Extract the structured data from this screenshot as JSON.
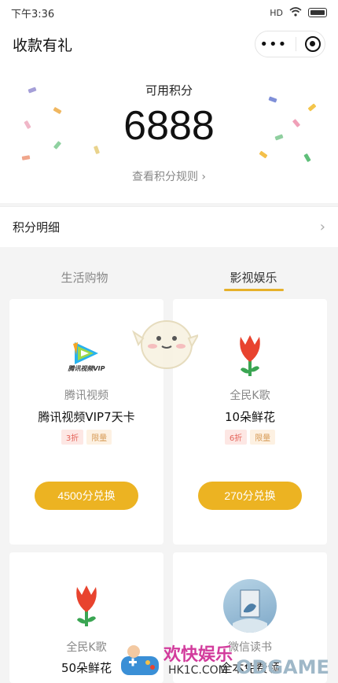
{
  "status_bar": {
    "time": "下午3:36",
    "signal": "HD",
    "wifi_icon": "wifi-icon",
    "battery_icon": "battery-icon"
  },
  "nav": {
    "title": "收款有礼",
    "more_icon": "more-icon",
    "close_icon": "target-icon"
  },
  "points": {
    "label": "可用积分",
    "value": "6888",
    "rules_link": "查看积分规则 ›"
  },
  "detail": {
    "label": "积分明细",
    "chevron_icon": "chevron-right-icon"
  },
  "tabs": [
    {
      "label": "生活购物",
      "active": false
    },
    {
      "label": "影视娱乐",
      "active": true
    }
  ],
  "products": [
    {
      "icon": "tencent-video-icon",
      "logo_text": "腾讯视频VIP",
      "brand": "腾讯视频",
      "name": "腾讯视频VIP7天卡",
      "tags": [
        "3折",
        "限量"
      ],
      "button": "4500分兑换"
    },
    {
      "icon": "tulip-icon",
      "brand": "全民K歌",
      "name": "10朵鲜花",
      "tags": [
        "6折",
        "限量"
      ],
      "button": "270分兑换"
    },
    {
      "icon": "tulip-icon",
      "brand": "全民K歌",
      "name": "50朵鲜花"
    },
    {
      "icon": "book-icon",
      "brand": "微信读书",
      "name": "全本免费领"
    }
  ],
  "watermark": {
    "main": "欢快娱乐",
    "sub": "HK1C.COM",
    "right": "ODGAME"
  },
  "colors": {
    "accent": "#ecb322",
    "discount": "#e4645a",
    "limit": "#d69a55"
  }
}
